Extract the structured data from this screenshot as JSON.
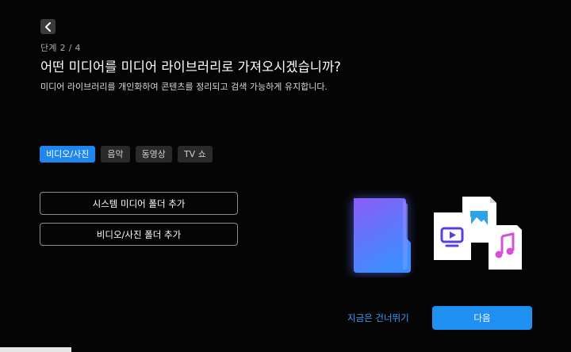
{
  "header": {
    "back_icon": "chevron-left-icon",
    "step_text": "단계 2 / 4",
    "title": "어떤 미디어를 미디어 라이브러리로 가져오시겠습니까?",
    "subtitle": "미디어 라이브러리를 개인화하여 콘텐츠를 정리되고 검색 가능하게 유지합니다."
  },
  "tabs": [
    {
      "label": "비디오/사진",
      "active": true
    },
    {
      "label": "음악",
      "active": false
    },
    {
      "label": "동영상",
      "active": false
    },
    {
      "label": "TV 쇼",
      "active": false
    }
  ],
  "buttons": {
    "add_system_folder": "시스템 미디어 폴더 추가",
    "add_video_photo_folder": "비디오/사진 폴더 추가"
  },
  "footer": {
    "skip_label": "지금은 건너뛰기",
    "next_label": "다음"
  },
  "colors": {
    "accent": "#1f8ff2",
    "active_tab": "#1f86f0",
    "link": "#3d9bf5",
    "folder_top": "#8b5cf6",
    "folder_bottom": "#3f8cff",
    "tv_icon": "#5a3fe0",
    "image_icon": "#2ea4e8",
    "music_icon": "#d64fd6"
  },
  "illustration_icons": [
    "folder-icon",
    "tv-icon",
    "image-icon",
    "music-note-icon"
  ]
}
